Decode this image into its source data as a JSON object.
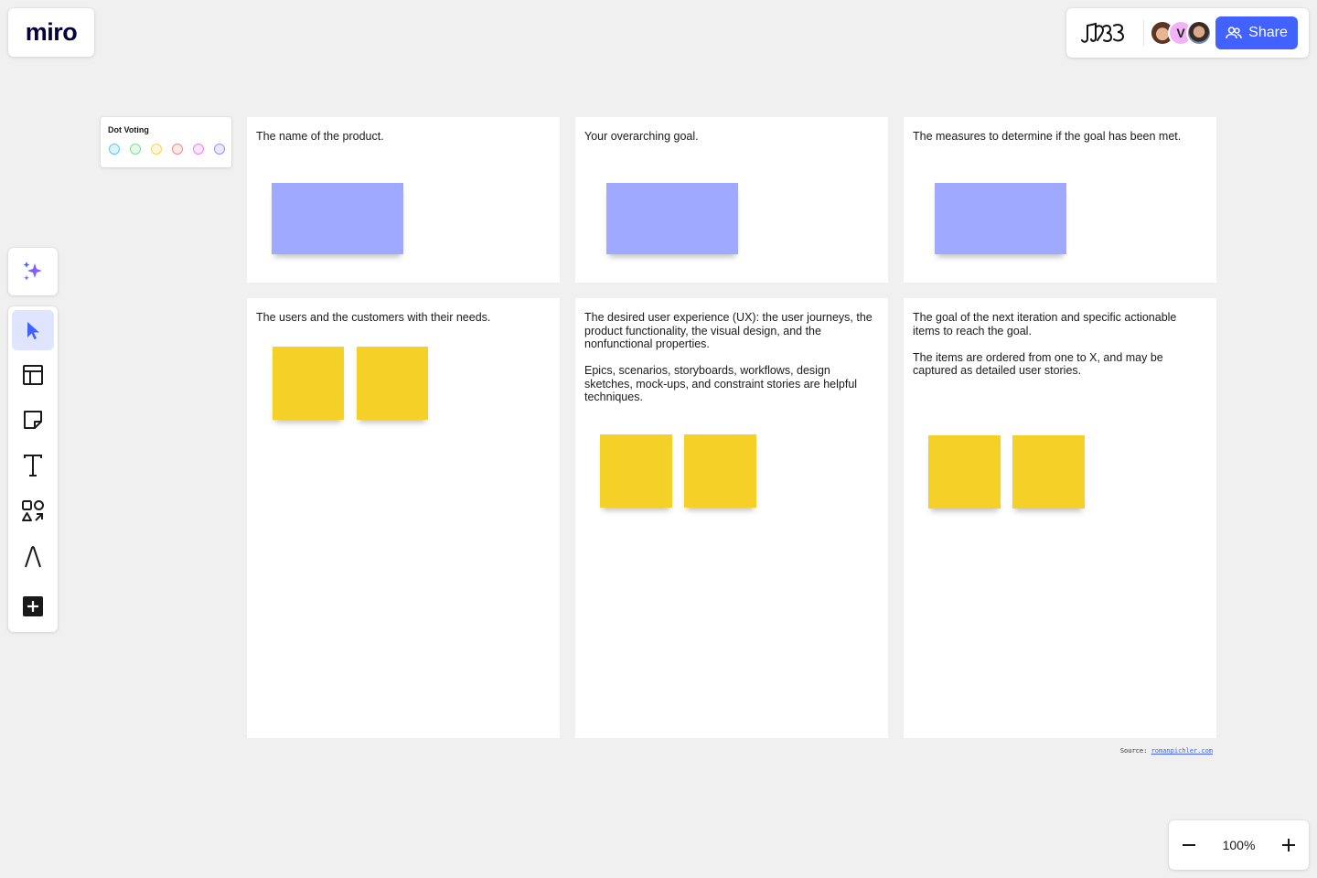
{
  "app": {
    "logo_text": "miro"
  },
  "header": {
    "share_label": "Share",
    "avatar_initial": "V"
  },
  "zoom": {
    "level_label": "100%"
  },
  "dot_voting": {
    "title": "Dot Voting",
    "dot_colors": [
      "#56c8ff",
      "#7ee08c",
      "#f8d84a",
      "#f38a8a",
      "#ef7df5",
      "#9a91ff"
    ]
  },
  "frames": [
    {
      "text": "The name of the product.",
      "sticky_color": "blue"
    },
    {
      "text": "Your overarching goal.",
      "sticky_color": "blue"
    },
    {
      "text": "The measures to determine if the goal has been met.",
      "sticky_color": "blue"
    },
    {
      "text": "The users and the customers with their needs.",
      "sticky_color": "yellow"
    },
    {
      "text": "The desired user experience (UX): the user journeys, the product functionality, the visual design, and the nonfunctional properties.\n\nEpics, scenarios, storyboards, workflows, design sketches, mock-ups, and constraint stories are helpful techniques.",
      "sticky_color": "yellow"
    },
    {
      "text": "The goal of the next iteration and specific actionable items to reach the goal.\n\nThe items are ordered from one to X, and may be captured as detailed user stories.",
      "sticky_color": "yellow"
    }
  ],
  "source": {
    "label": "Source:",
    "link": "romanpichler.com"
  },
  "colors": {
    "accent": "#4262ff",
    "sticky_blue": "#9ea9ff",
    "sticky_yellow": "#f5d128"
  }
}
